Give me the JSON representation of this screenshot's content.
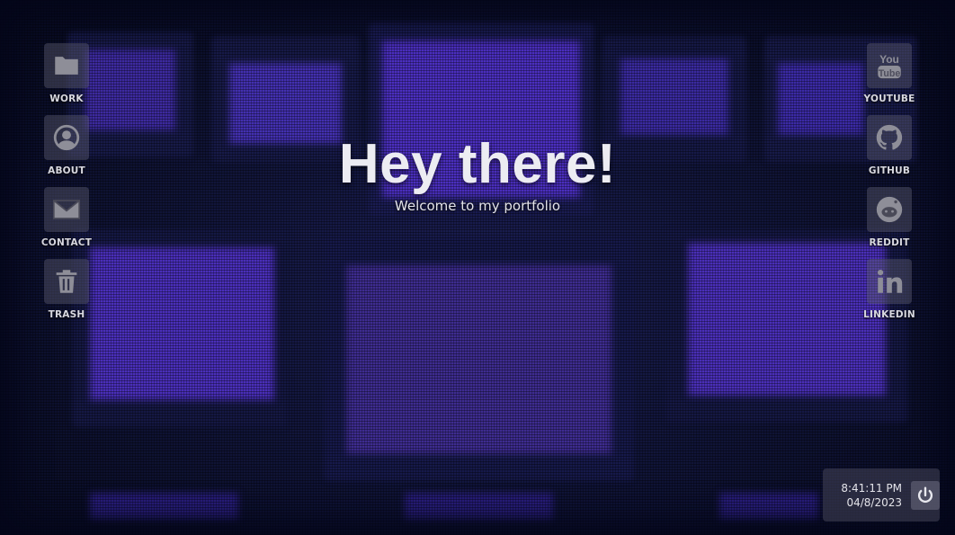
{
  "desktop": {
    "left_icons": [
      {
        "label": "WORK",
        "icon": "folder-icon"
      },
      {
        "label": "ABOUT",
        "icon": "user-icon"
      },
      {
        "label": "CONTACT",
        "icon": "mail-icon"
      },
      {
        "label": "TRASH",
        "icon": "trash-icon"
      }
    ],
    "right_icons": [
      {
        "label": "YOUTUBE",
        "icon": "youtube-icon"
      },
      {
        "label": "GITHUB",
        "icon": "github-icon"
      },
      {
        "label": "REDDIT",
        "icon": "reddit-icon"
      },
      {
        "label": "LINKEDIN",
        "icon": "linkedin-icon"
      }
    ]
  },
  "hero": {
    "title": "Hey there!",
    "subtitle": "Welcome to my portfolio"
  },
  "taskbar": {
    "time": "8:41:11 PM",
    "date": "04/8/2023",
    "power_icon": "power-icon"
  },
  "colors": {
    "background": "#0b0f2a",
    "accent_purple": "#4a2fb0",
    "text": "#ececf2"
  }
}
